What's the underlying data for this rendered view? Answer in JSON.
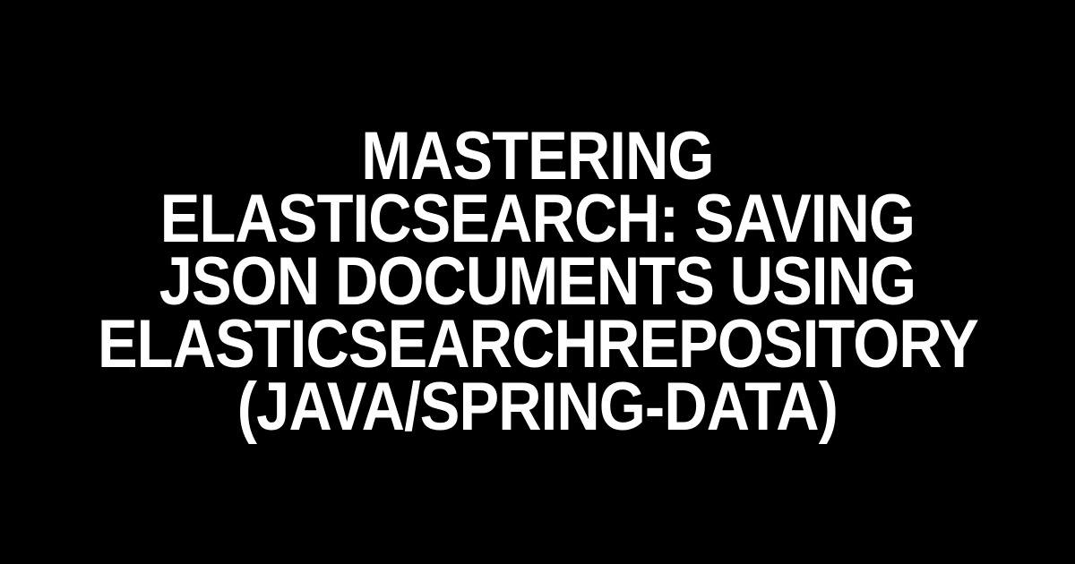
{
  "title": "Mastering Elasticsearch: Saving JSON Documents using ElasticsearchRepository (Java/Spring-data)"
}
